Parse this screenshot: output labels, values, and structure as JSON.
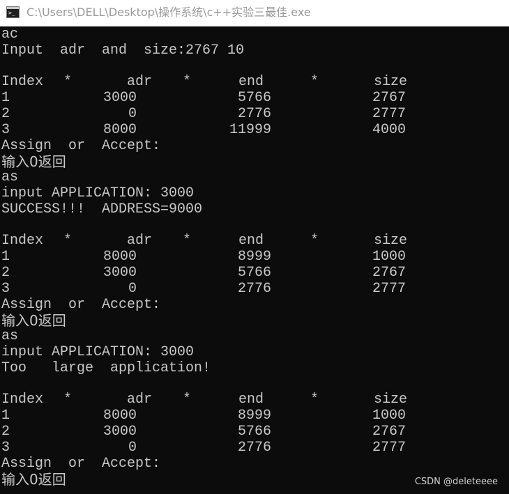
{
  "window": {
    "title": "C:\\Users\\DELL\\Desktop\\操作系统\\c++实验三最佳.exe",
    "icon": "console-app-icon",
    "icon_prompt": ">_"
  },
  "console": {
    "block1": {
      "cmd": "ac",
      "input_line": "Input  adr  and  size:2767 10"
    },
    "table1": {
      "header": {
        "index": "Index",
        "star1": "*",
        "adr": "adr",
        "star2": "*",
        "end": "end",
        "star3": "*",
        "size": "size"
      },
      "rows": [
        {
          "index": "1",
          "adr": "3000",
          "end": "5766",
          "size": "2767"
        },
        {
          "index": "2",
          "adr": "0",
          "end": "2776",
          "size": "2777"
        },
        {
          "index": "3",
          "adr": "8000",
          "end": "11999",
          "size": "4000"
        }
      ],
      "assign_prompt": "Assign  or  Accept:",
      "return_hint": "输入0返回"
    },
    "block2": {
      "cmd": "as",
      "input_line": "input APPLICATION: 3000",
      "result": "SUCCESS!!!  ADDRESS=9000"
    },
    "table2": {
      "header": {
        "index": "Index",
        "star1": "*",
        "adr": "adr",
        "star2": "*",
        "end": "end",
        "star3": "*",
        "size": "size"
      },
      "rows": [
        {
          "index": "1",
          "adr": "8000",
          "end": "8999",
          "size": "1000"
        },
        {
          "index": "2",
          "adr": "3000",
          "end": "5766",
          "size": "2767"
        },
        {
          "index": "3",
          "adr": "0",
          "end": "2776",
          "size": "2777"
        }
      ],
      "assign_prompt": "Assign  or  Accept:",
      "return_hint": "输入0返回"
    },
    "block3": {
      "cmd": "as",
      "input_line": "input APPLICATION: 3000",
      "result": "Too   large  application!"
    },
    "table3": {
      "header": {
        "index": "Index",
        "star1": "*",
        "adr": "adr",
        "star2": "*",
        "end": "end",
        "star3": "*",
        "size": "size"
      },
      "rows": [
        {
          "index": "1",
          "adr": "8000",
          "end": "8999",
          "size": "1000"
        },
        {
          "index": "2",
          "adr": "3000",
          "end": "5766",
          "size": "2767"
        },
        {
          "index": "3",
          "adr": "0",
          "end": "2776",
          "size": "2777"
        }
      ],
      "assign_prompt": "Assign  or  Accept:",
      "return_hint": "输入0返回"
    }
  },
  "watermark": "CSDN @deleteeee",
  "colors": {
    "console_bg": "#0c0c0c",
    "console_text": "#c8c8c8",
    "titlebar_bg": "#ffffff",
    "title_text": "#9a9a9a"
  }
}
